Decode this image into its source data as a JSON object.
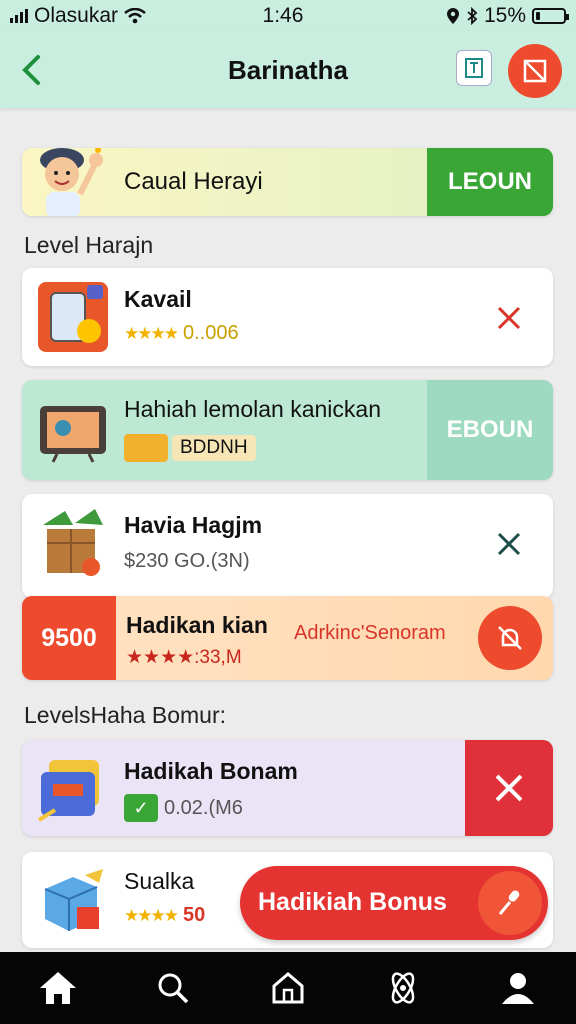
{
  "status_bar": {
    "carrier": "Olasukar",
    "time": "1:46",
    "battery_percent": "15%",
    "battery_level": 0.15
  },
  "header": {
    "title": "Barinatha"
  },
  "banner": {
    "text": "Caual Herayi",
    "button": "LEOUN",
    "accent": "#3aa635"
  },
  "section_1": {
    "title": "Level Harajn"
  },
  "items": [
    {
      "title": "Kavail",
      "stars": "★★★★",
      "sub": "0..006"
    },
    {
      "title": "Hahiah lemolan kanickan",
      "badge": "BDDNH",
      "button": "EBOUN"
    },
    {
      "title": "Havia Hagjm",
      "sub": "$230 GO.(3N)"
    }
  ],
  "promo": {
    "amount": "9500",
    "title": "Hadikan kian",
    "sub": "★★★★:33,M",
    "tag": "Adrkinc'Senoram",
    "accent": "#ee4a2e"
  },
  "section_2": {
    "title": "LevelsHaha Bomur:"
  },
  "bonus_item": {
    "title": "Hadikah Bonam",
    "sub": "0.02.(M6"
  },
  "last_item": {
    "title": "Sualka",
    "stars": "★★★★",
    "value": "50"
  },
  "cta": {
    "label": "Hadikiah Bonus"
  },
  "nav": [
    {
      "name": "home-icon"
    },
    {
      "name": "search-icon"
    },
    {
      "name": "house-outline-icon"
    },
    {
      "name": "atom-icon"
    },
    {
      "name": "profile-icon"
    }
  ]
}
